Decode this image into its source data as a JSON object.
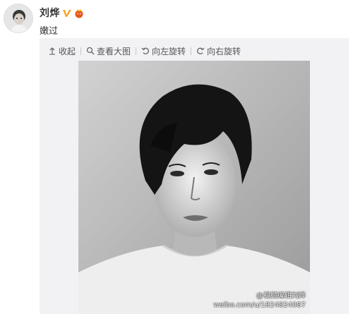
{
  "post": {
    "author": "刘烨",
    "text": "嫩过"
  },
  "toolbar": {
    "collapse": "收起",
    "view_large": "查看大图",
    "rotate_left": "向左旋转",
    "rotate_right": "向右旋转"
  },
  "photo": {
    "watermark_line1": "@视频编辑刘烨",
    "watermark_line2": "weibo.com/u/1824824087"
  },
  "colors": {
    "vip_badge": "#f5a623",
    "member_icon": "#e8541c",
    "panel_bg": "#f2f2f5"
  },
  "icons": [
    "avatar",
    "vip-badge-icon",
    "member-icon",
    "arrow-up-icon",
    "magnifier-icon",
    "rotate-left-icon",
    "rotate-right-icon"
  ]
}
